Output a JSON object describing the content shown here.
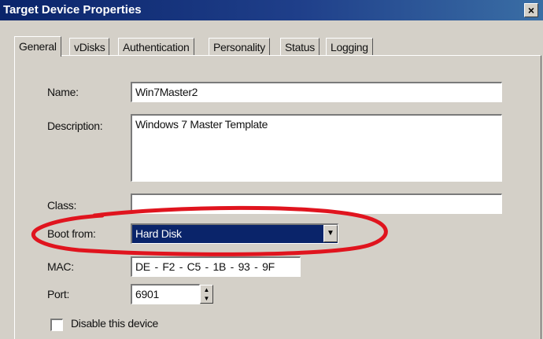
{
  "window": {
    "title": "Target Device Properties",
    "close_glyph": "×"
  },
  "tabs": [
    {
      "label": "General",
      "active": true
    },
    {
      "label": "vDisks"
    },
    {
      "label": "Authentication"
    },
    {
      "label": "Personality"
    },
    {
      "label": "Status"
    },
    {
      "label": "Logging"
    }
  ],
  "form": {
    "name": {
      "label": "Name:",
      "value": "Win7Master2"
    },
    "description": {
      "label": "Description:",
      "value": "Windows 7 Master Template"
    },
    "class": {
      "label": "Class:",
      "value": ""
    },
    "boot_from": {
      "label": "Boot from:",
      "value": "Hard Disk"
    },
    "mac": {
      "label": "MAC:",
      "value": "DE - F2 - C5 - 1B - 93 - 9F"
    },
    "port": {
      "label": "Port:",
      "value": "6901"
    },
    "disable": {
      "label": "Disable this device",
      "checked": false
    }
  },
  "annotation": {
    "color": "#e0141e",
    "shape": "red-ellipse-highlight"
  }
}
